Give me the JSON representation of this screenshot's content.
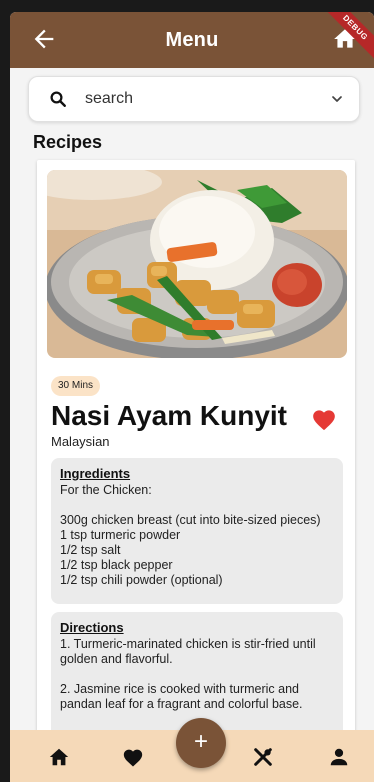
{
  "app": {
    "title": "Menu",
    "debug_label": "DEBUG",
    "accent_color": "#7a5337",
    "nav_color": "#f5d9b8"
  },
  "search": {
    "placeholder": "search",
    "icon": "search-icon",
    "dropdown_icon": "chevron-down-icon"
  },
  "section_title": "Recipes",
  "recipe": {
    "time_badge": "30 Mins",
    "name": "Nasi Ayam Kunyit",
    "cuisine": "Malaysian",
    "favorite": true,
    "favorite_color": "#e53935",
    "ingredients_title": "Ingredients",
    "ingredients_text": "For the Chicken:\n\n300g chicken breast (cut into bite-sized pieces)\n1 tsp turmeric powder\n1/2 tsp salt\n1/2 tsp black pepper\n1/2 tsp chili powder (optional)",
    "directions_title": "Directions",
    "directions_text": "1. Turmeric-marinated chicken is stir-fried until golden and flavorful.\n\n2. Jasmine rice is cooked with turmeric and pandan leaf for a fragrant and colorful base."
  },
  "bottom_nav": {
    "items": [
      "home-icon",
      "heart-icon",
      "add-icon",
      "utensils-icon",
      "person-icon"
    ],
    "fab_label": "+"
  }
}
